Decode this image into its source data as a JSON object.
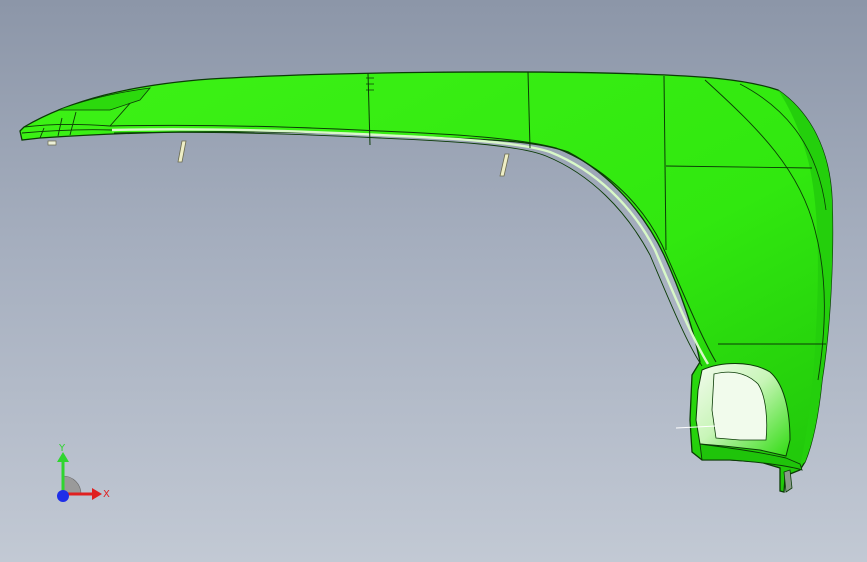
{
  "viewport": {
    "background_top": "#8c96a8",
    "background_bottom": "#c2c9d4"
  },
  "model": {
    "part_type": "fender-flare",
    "body_color": "#33ee11",
    "shade_color": "#22cc0a",
    "edge_color": "#0b3b06"
  },
  "triad": {
    "y_label": "Y",
    "x_label": "X",
    "y_color": "#2fd52f",
    "x_color": "#e02020",
    "z_color": "#1e2ee8"
  }
}
